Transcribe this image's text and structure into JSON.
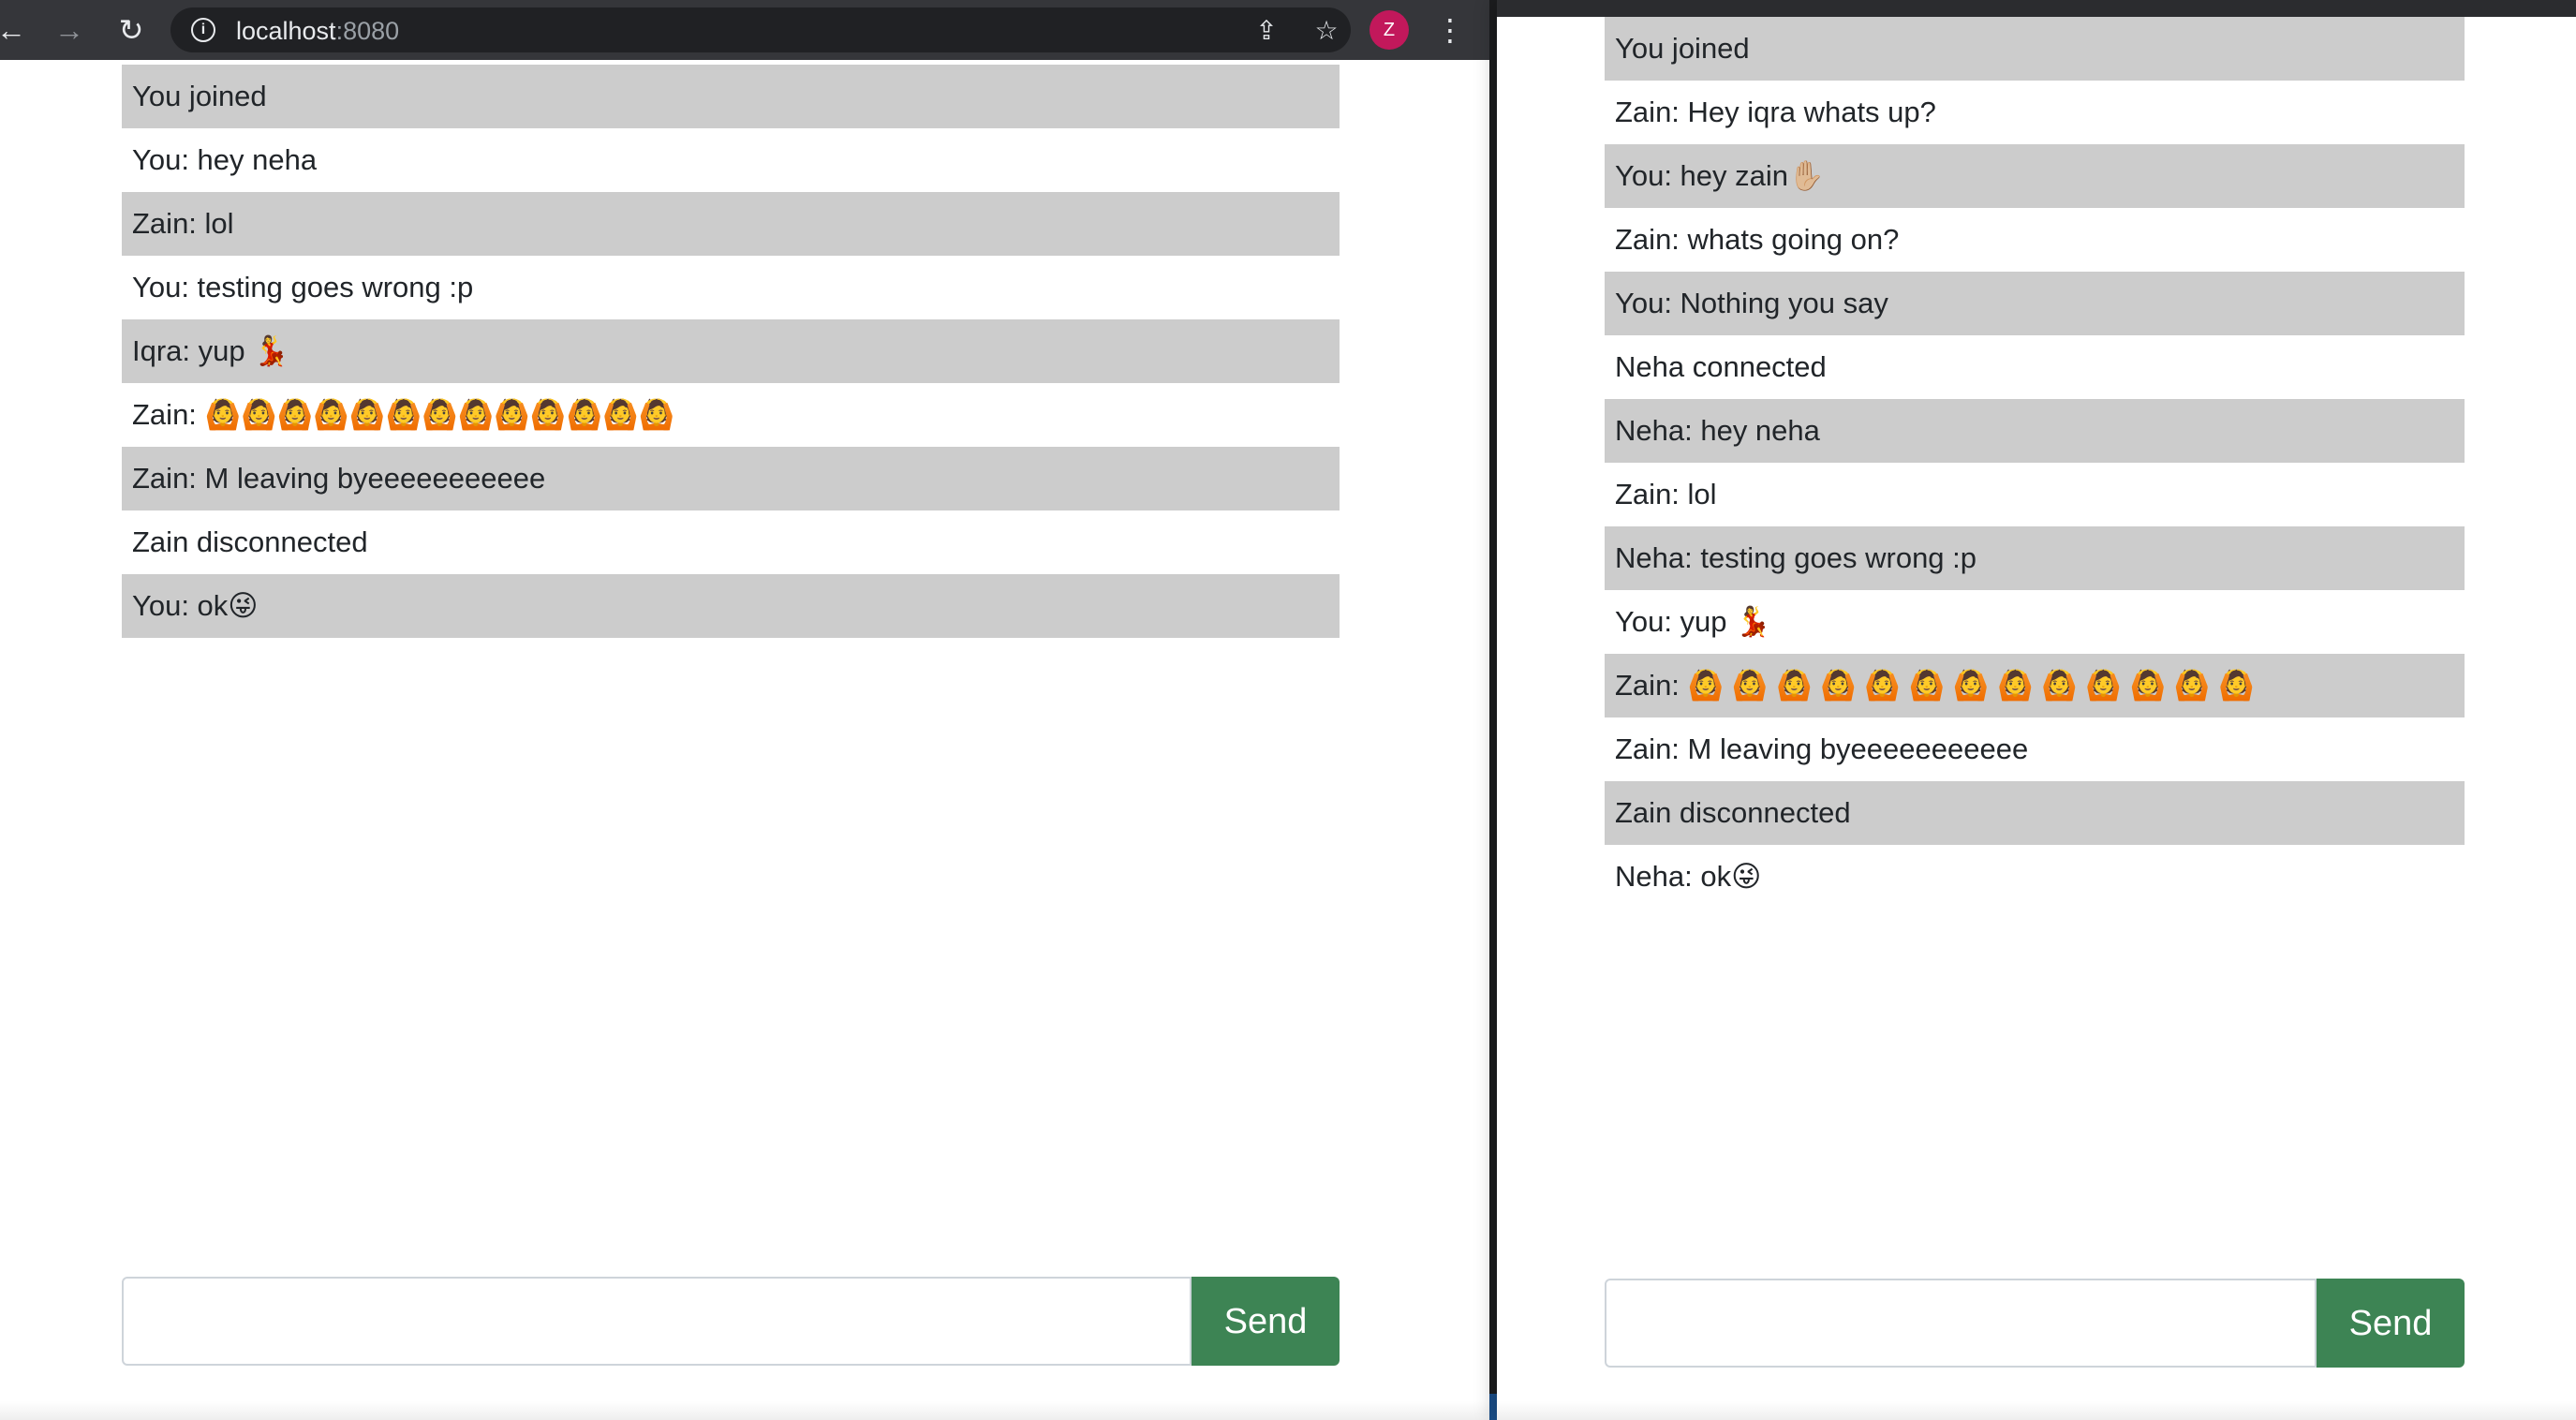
{
  "browser": {
    "address_host": "localhost",
    "address_port": ":8080",
    "profile_initial": "Z",
    "icons": [
      "back-arrow-icon",
      "forward-arrow-icon",
      "reload-icon",
      "site-info-icon",
      "share-icon",
      "bookmark-star-icon",
      "profile-avatar",
      "kebab-menu-icon"
    ]
  },
  "left_chat": {
    "messages": [
      "You joined",
      "You: hey neha",
      "Zain: lol",
      "You: testing goes wrong :p",
      "Iqra: yup 💃",
      "Zain: 🙆🙆🙆🙆🙆🙆🙆🙆🙆🙆🙆🙆🙆",
      "Zain: M leaving byeeeeeeeeeee",
      "Zain disconnected",
      "You: ok😜"
    ],
    "input_value": "",
    "send_label": "Send"
  },
  "right_chat": {
    "messages": [
      "You joined",
      "Zain: Hey iqra whats up?",
      "You: hey zain✋🏼",
      "Zain: whats going on?",
      "You: Nothing you say",
      "Neha connected",
      "Neha: hey neha",
      "Zain: lol",
      "Neha: testing goes wrong :p",
      "You: yup 💃",
      "Zain: 🙆 🙆 🙆 🙆 🙆 🙆 🙆 🙆 🙆 🙆 🙆 🙆 🙆",
      "Zain: M leaving byeeeeeeeeeee",
      "Zain disconnected",
      "Neha: ok😜"
    ],
    "input_value": "",
    "send_label": "Send"
  },
  "colors": {
    "toolbar_bg": "#35363a",
    "omnibox_bg": "#202124",
    "message_stripe": "#cccccc",
    "send_button": "#3d8454",
    "avatar": "#c2185b"
  }
}
